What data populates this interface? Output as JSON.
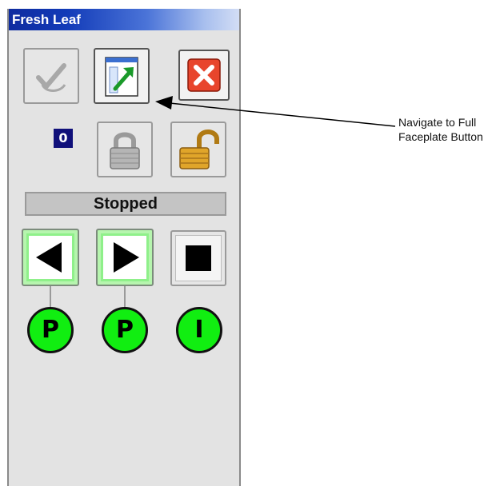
{
  "faceplate": {
    "title": "Fresh Leaf",
    "counter_value": "0",
    "status_text": "Stopped"
  },
  "buttons": {
    "acknowledge": {
      "icon": "acknowledge-check-icon",
      "enabled": false
    },
    "full_faceplate": {
      "icon": "navigate-full-faceplate-icon",
      "enabled": true
    },
    "close": {
      "icon": "close-x-icon",
      "enabled": true
    },
    "lock": {
      "icon": "padlock-locked-icon",
      "enabled": false
    },
    "unlock": {
      "icon": "padlock-unlocked-icon",
      "enabled": true
    },
    "reverse": {
      "icon": "left-arrow-icon",
      "active": true
    },
    "forward": {
      "icon": "right-arrow-icon",
      "active": true
    },
    "stop": {
      "icon": "stop-square-icon",
      "active": false
    }
  },
  "indicators": [
    {
      "label": "P"
    },
    {
      "label": "P"
    },
    {
      "label": "I"
    }
  ],
  "annotation": {
    "line1": "Navigate to Full",
    "line2": "Faceplate Button"
  },
  "colors": {
    "title_bar": "#123bb8",
    "active_button": "#b6f5ae",
    "indicator": "#11ee11",
    "close_button": "#e8452c",
    "counter_bg": "#10107a"
  }
}
